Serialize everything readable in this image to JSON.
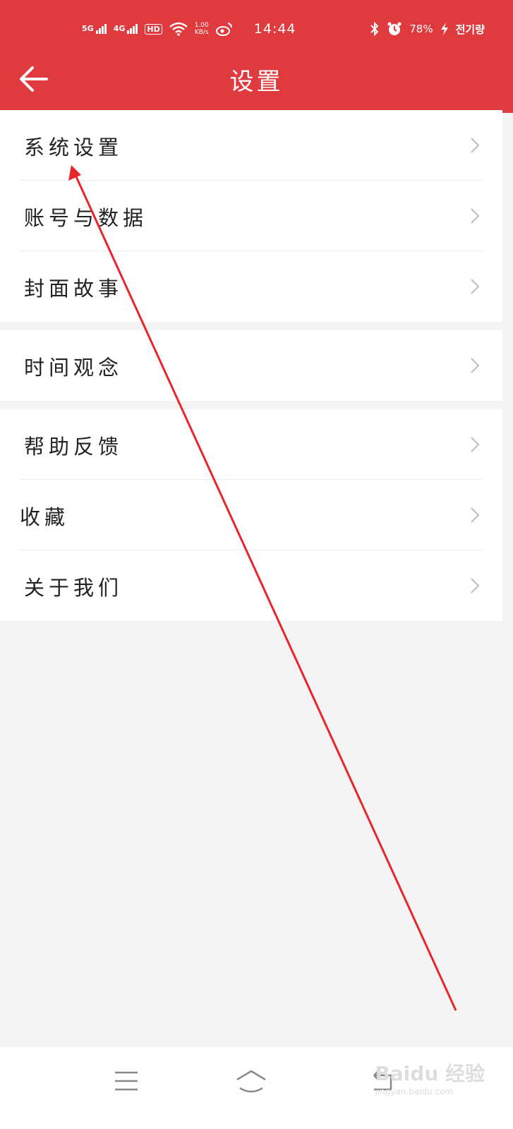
{
  "status_bar": {
    "net1": "5G",
    "net2": "4G",
    "hd": "HD",
    "speed": "1.00",
    "speed_unit": "KB/s",
    "time": "14:44",
    "battery": "78%",
    "carrier": "전기량"
  },
  "header": {
    "title": "设置"
  },
  "groups": [
    {
      "items": [
        {
          "label": "系统设置"
        },
        {
          "label": "账号与数据"
        },
        {
          "label": "封面故事"
        }
      ]
    },
    {
      "items": [
        {
          "label": "时间观念"
        }
      ]
    },
    {
      "items": [
        {
          "label": "帮助反馈"
        },
        {
          "label": "收藏"
        },
        {
          "label": "关于我们"
        }
      ]
    }
  ],
  "watermark": {
    "brand": "Baidu 经验",
    "url": "jingyan.baidu.com"
  },
  "annotation_color": "#e8262a",
  "accent_color": "#df3a3e"
}
